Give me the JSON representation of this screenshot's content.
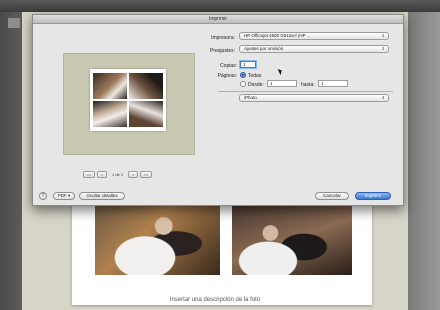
{
  "dialog": {
    "title": "Imprimir"
  },
  "form": {
    "printer_label": "Impresora:",
    "printer_value": "HP Officejet 4500 G510a-f (HP ...",
    "presets_label": "Preajustes:",
    "presets_value": "Ajustes por omisión",
    "copies_label": "Copias:",
    "copies_value": "1",
    "pages_label": "Páginas:",
    "pages_all": "Todas",
    "pages_from": "Desde:",
    "pages_from_value": "1",
    "pages_to": "hasta:",
    "pages_to_value": "1",
    "app_section": "iPhoto"
  },
  "pager": {
    "first": "<<",
    "prev": "<",
    "page_label": "1 de 1",
    "next": ">",
    "last": ">>"
  },
  "footer": {
    "help": "?",
    "pdf_label": "PDF ▾",
    "details_label": "Ocultar detalles",
    "cancel_label": "Cancelar",
    "print_label": "Imprimir"
  },
  "background": {
    "caption": "Insertar una descripción de la foto"
  }
}
